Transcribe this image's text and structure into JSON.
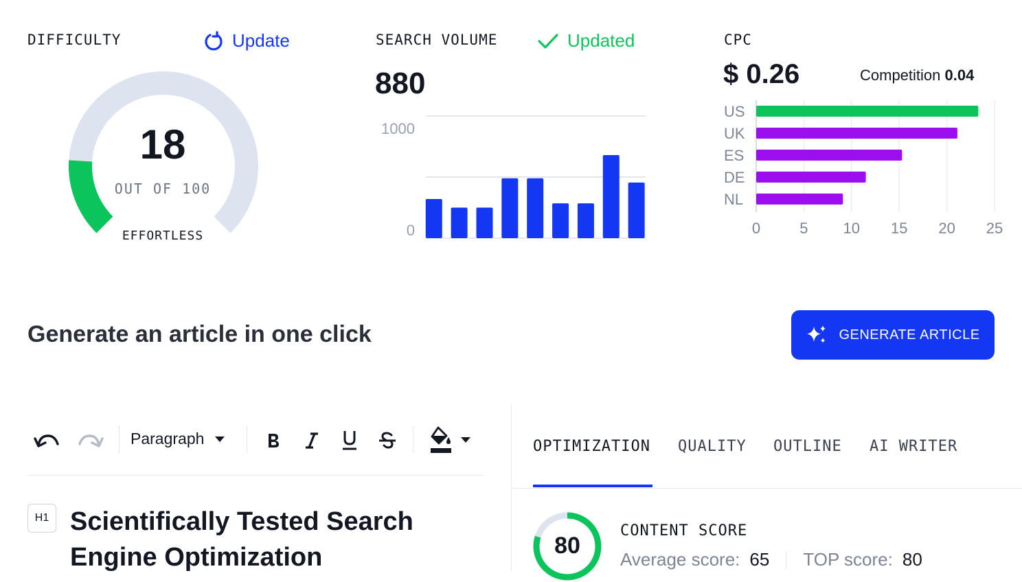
{
  "difficulty": {
    "title": "DIFFICULTY",
    "update_label": "Update",
    "value": "18",
    "out_of": "OUT OF 100",
    "caption": "EFFORTLESS",
    "fraction": 0.18,
    "colors": {
      "fill": "#0cc45c",
      "track": "#dde3ef"
    }
  },
  "search_volume": {
    "title": "SEARCH VOLUME",
    "status_label": "Updated",
    "value": "880"
  },
  "cpc": {
    "title": "CPC",
    "value": "$ 0.26",
    "competition_label": "Competition",
    "competition_value": "0.04"
  },
  "cta": {
    "title": "Generate an article in one click",
    "button_label": "GENERATE ARTICLE"
  },
  "editor": {
    "block_type": "Paragraph",
    "heading_badge": "H1",
    "heading_text": "Scientifically Tested Search Engine Optimization"
  },
  "panel": {
    "tabs": [
      {
        "label": "OPTIMIZATION"
      },
      {
        "label": "QUALITY"
      },
      {
        "label": "OUTLINE"
      },
      {
        "label": "AI WRITER"
      }
    ],
    "content_score": {
      "label": "CONTENT SCORE",
      "value": "80",
      "fraction": 0.8,
      "average_label": "Average score:",
      "average_value": "65",
      "top_label": "TOP score:",
      "top_value": "80"
    }
  },
  "colors": {
    "accent": "#1437f4",
    "green": "#0cc45c",
    "purple": "#9b0ef0"
  },
  "chart_data": [
    {
      "type": "bar",
      "y_ticks": [
        "1000",
        "0"
      ],
      "ylim": [
        0,
        1000
      ],
      "values": [
        320,
        250,
        250,
        490,
        490,
        285,
        285,
        680,
        455
      ],
      "grid": true
    },
    {
      "type": "bar",
      "orientation": "horizontal",
      "categories": [
        "US",
        "UK",
        "ES",
        "DE",
        "NL"
      ],
      "values": [
        23.3,
        21.1,
        15.3,
        11.5,
        9.1
      ],
      "x_ticks": [
        "0",
        "5",
        "10",
        "15",
        "20",
        "25"
      ],
      "xlim": [
        0,
        25
      ],
      "grid": true
    }
  ]
}
